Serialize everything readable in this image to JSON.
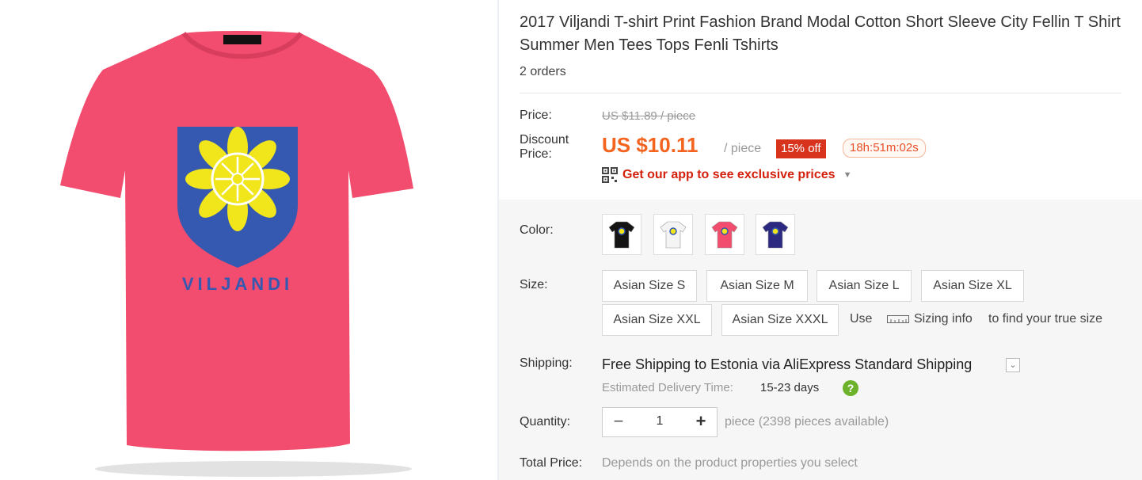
{
  "product": {
    "title": "2017 Viljandi T-shirt Print Fashion Brand Modal Cotton Short Sleeve City Fellin T Shirt Summer Men Tees Tops Fenli Tshirts",
    "orders": "2 orders",
    "image": {
      "shirt_color": "#f24d6e",
      "shield_color": "#3558b0",
      "flower_color": "#f1e51c",
      "print_text": "VILJANDI"
    }
  },
  "pricing": {
    "price_label": "Price:",
    "original_price": "US $11.89 / piece",
    "discount_label_line1": "Discount",
    "discount_label_line2": "Price:",
    "discount_price": "US $10.11",
    "unit": "/ piece",
    "discount_badge": "15% off",
    "timer": "18h:51m:02s",
    "app_promo": "Get our app to see exclusive prices",
    "accent": "#f5641e",
    "badge_color": "#d7331d"
  },
  "options": {
    "color_label": "Color:",
    "color_swatches": [
      {
        "name": "black",
        "color": "#141414"
      },
      {
        "name": "white",
        "color": "#f4f4f4"
      },
      {
        "name": "pink",
        "color": "#f24d6e"
      },
      {
        "name": "navy",
        "color": "#2b2a80"
      }
    ],
    "size_label": "Size:",
    "sizes": [
      "Asian Size S",
      "Asian Size M",
      "Asian Size L",
      "Asian Size XL",
      "Asian Size XXL",
      "Asian Size XXXL"
    ],
    "size_use": "Use",
    "sizing_info": "Sizing info",
    "size_suffix": "to find your true size"
  },
  "shipping": {
    "label": "Shipping:",
    "method": "Free Shipping to Estonia via AliExpress Standard Shipping",
    "estimate_label": "Estimated Delivery Time:",
    "estimate_days": "15-23 days"
  },
  "quantity": {
    "label": "Quantity:",
    "value": "1",
    "availability": "piece (2398 pieces available)"
  },
  "total": {
    "label": "Total Price:",
    "value": "Depends on the product properties you select"
  }
}
